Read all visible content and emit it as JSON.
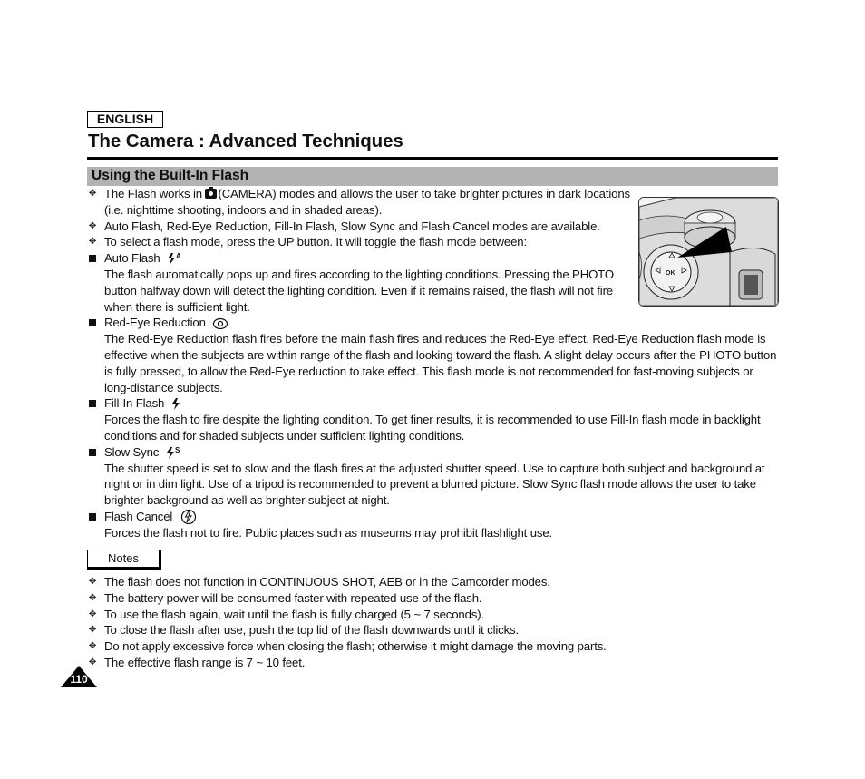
{
  "header": {
    "language": "ENGLISH",
    "title": "The Camera : Advanced Techniques"
  },
  "section": {
    "title": "Using the Built-In Flash"
  },
  "intro_bullets": [
    {
      "before_icon": "The Flash works in ",
      "icon": "camera-icon",
      "after_icon": "(CAMERA) modes and allows the user to take brighter pictures in dark locations (i.e. nighttime shooting, indoors and in shaded areas)."
    },
    {
      "text": "Auto Flash, Red-Eye Reduction, Fill-In Flash, Slow Sync and Flash Cancel modes are available."
    },
    {
      "text": "To select a flash mode, press the UP button. It will toggle the flash mode between:"
    }
  ],
  "modes": [
    {
      "name": "Auto Flash",
      "icon": "auto-flash-icon",
      "icon_letter": "A",
      "description": "The flash automatically pops up and fires according to the lighting conditions. Pressing the PHOTO button halfway down will detect the lighting condition. Even if it remains raised, the flash will not fire when there is sufficient light."
    },
    {
      "name": "Red-Eye Reduction",
      "icon": "red-eye-icon",
      "description": "The Red-Eye Reduction flash fires before the main flash fires and reduces the Red-Eye effect. Red-Eye Reduction flash mode is effective when the subjects are within range of the flash and looking toward the flash. A slight delay occurs after the PHOTO button is fully pressed, to allow the Red-Eye reduction to take effect. This flash mode is not recommended for fast-moving subjects or long-distance subjects."
    },
    {
      "name": "Fill-In Flash",
      "icon": "fill-in-flash-icon",
      "description": "Forces the flash to fire despite the lighting condition. To get finer results, it is recommended to use Fill-In flash mode in backlight conditions and for shaded subjects under sufficient lighting conditions."
    },
    {
      "name": "Slow Sync",
      "icon": "slow-sync-icon",
      "icon_letter": "S",
      "description": "The shutter speed is set to slow and the flash fires at the adjusted shutter speed. Use to capture both subject and background at night or in dim light. Use of a tripod is recommended to prevent a blurred picture. Slow Sync flash mode allows the user to take brighter background as well as brighter subject at night."
    },
    {
      "name": "Flash Cancel",
      "icon": "flash-cancel-icon",
      "description": "Forces the flash not to fire. Public places such as museums may prohibit flashlight use."
    }
  ],
  "illustration": {
    "subject": "camera-dial-illustration",
    "button_label": "OK"
  },
  "notes": {
    "label": "Notes",
    "items": [
      "The flash does not function in CONTINUOUS SHOT, AEB or in the Camcorder modes.",
      "The battery power will be consumed faster with repeated use of the flash.",
      "To use the flash again, wait until the flash is fully charged (5 ~ 7 seconds).",
      "To close the flash after use, push the top lid of the flash downwards until it clicks.",
      "Do not apply excessive force when closing the flash; otherwise it might damage the moving parts.",
      "The effective flash range is 7 ~ 10 feet."
    ]
  },
  "footer": {
    "page_number": "110"
  },
  "symbols": {
    "diamond_bullet": "✥"
  }
}
